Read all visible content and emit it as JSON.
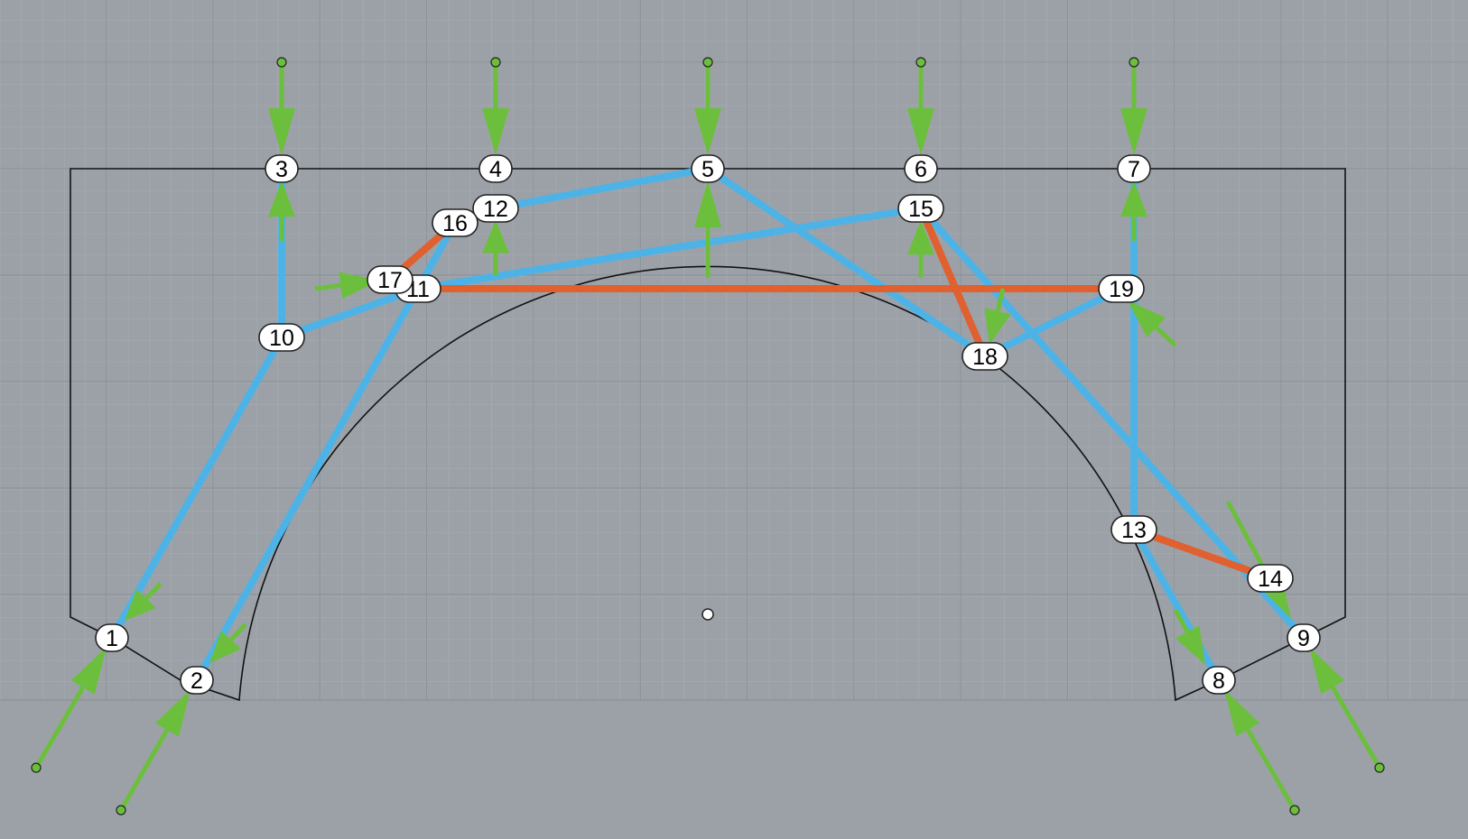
{
  "colors": {
    "background": "#9ca1a8",
    "grid_minor": "#a6abb2",
    "grid_major": "#8a8f96",
    "outline": "#111111",
    "compression_member": "#4db3e6",
    "tension_member": "#e0602f",
    "load_arrow": "#6cbf3c",
    "node_fill": "#ffffff",
    "node_stroke": "#222222"
  },
  "nodes": [
    {
      "id": "1"
    },
    {
      "id": "2"
    },
    {
      "id": "3"
    },
    {
      "id": "4"
    },
    {
      "id": "5"
    },
    {
      "id": "6"
    },
    {
      "id": "7"
    },
    {
      "id": "8"
    },
    {
      "id": "9"
    },
    {
      "id": "10"
    },
    {
      "id": "11"
    },
    {
      "id": "12"
    },
    {
      "id": "13"
    },
    {
      "id": "14"
    },
    {
      "id": "15"
    },
    {
      "id": "16"
    },
    {
      "id": "17"
    },
    {
      "id": "18"
    },
    {
      "id": "19"
    }
  ],
  "members": [
    {
      "from": "1",
      "to": "10",
      "kind": "compression"
    },
    {
      "from": "10",
      "to": "3",
      "kind": "compression"
    },
    {
      "from": "10",
      "to": "11",
      "kind": "compression"
    },
    {
      "from": "2",
      "to": "11",
      "kind": "compression"
    },
    {
      "from": "11",
      "to": "16",
      "kind": "compression"
    },
    {
      "from": "11",
      "to": "15",
      "kind": "compression"
    },
    {
      "from": "12",
      "to": "5",
      "kind": "compression"
    },
    {
      "from": "5",
      "to": "18",
      "kind": "compression"
    },
    {
      "from": "18",
      "to": "19",
      "kind": "compression"
    },
    {
      "from": "15",
      "to": "9",
      "kind": "compression"
    },
    {
      "from": "7",
      "to": "13",
      "kind": "compression"
    },
    {
      "from": "13",
      "to": "8",
      "kind": "compression"
    },
    {
      "from": "17",
      "to": "16",
      "kind": "tension"
    },
    {
      "from": "11",
      "to": "19",
      "kind": "tension"
    },
    {
      "from": "15",
      "to": "18",
      "kind": "tension"
    },
    {
      "from": "13",
      "to": "14",
      "kind": "tension"
    }
  ]
}
